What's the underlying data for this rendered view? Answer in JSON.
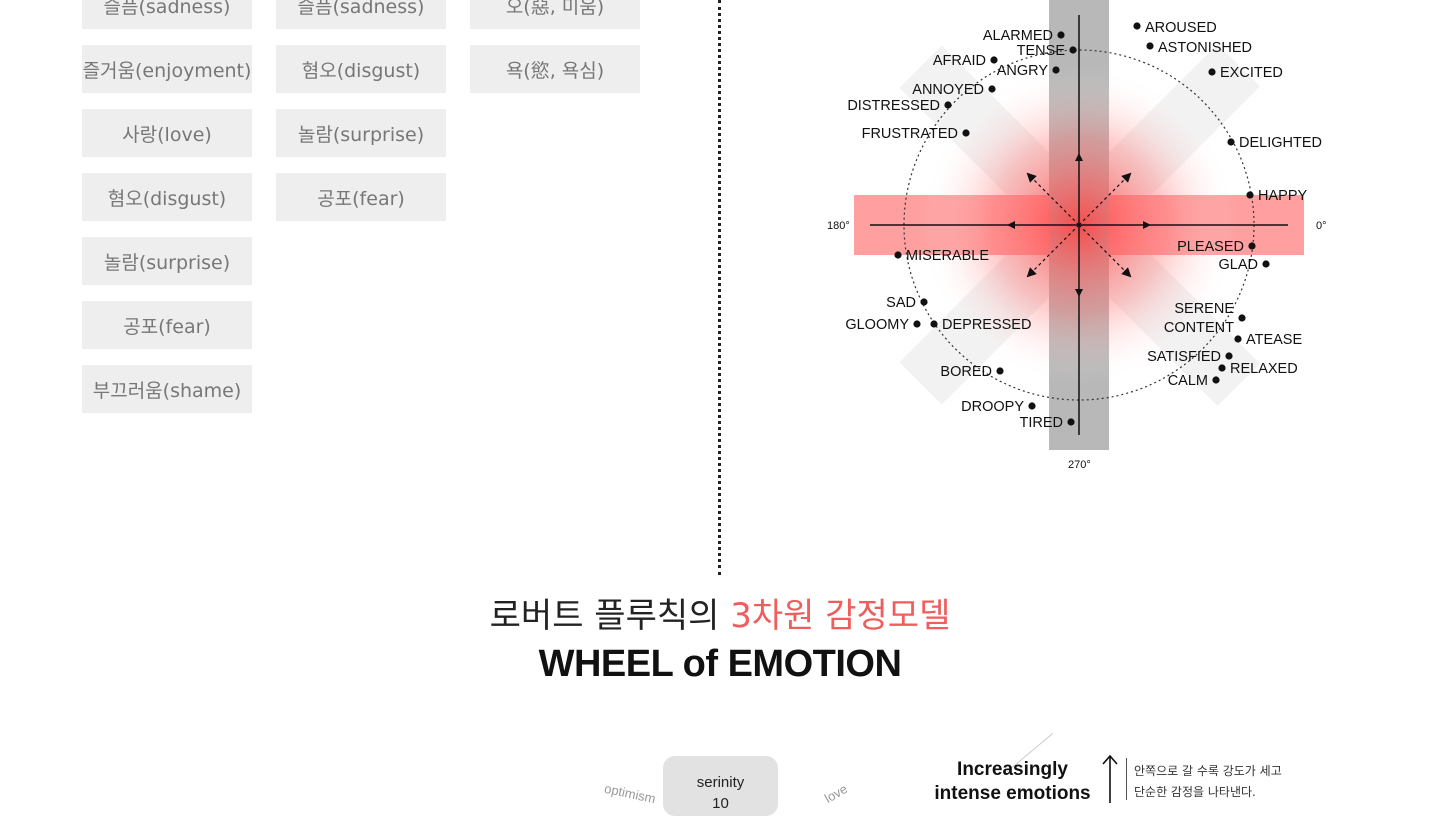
{
  "emotion_columns": [
    [
      "슬픔(sadness)",
      "즐거움(enjoyment)",
      "사랑(love)",
      "혐오(disgust)",
      "놀람(surprise)",
      "공포(fear)",
      "부끄러움(shame)"
    ],
    [
      "슬픔(sadness)",
      "혐오(disgust)",
      "놀람(surprise)",
      "공포(fear)"
    ],
    [
      "오(惡, 미움)",
      "욕(慾, 욕심)"
    ]
  ],
  "circumplex": {
    "degree_labels": {
      "right": "0°",
      "left": "180°",
      "bottom": "270°"
    },
    "words": {
      "aroused": "AROUSED",
      "astonished": "ASTONISHED",
      "alarmed": "ALARMED",
      "tense": "TENSE",
      "afraid": "AFRAID",
      "angry": "ANGRY",
      "excited": "EXCITED",
      "annoyed": "ANNOYED",
      "distressed": "DISTRESSED",
      "frustrated": "FRUSTRATED",
      "delighted": "DELIGHTED",
      "happy": "HAPPY",
      "pleased": "PLEASED",
      "glad": "GLAD",
      "miserable": "MISERABLE",
      "sad": "SAD",
      "gloomy": "GLOOMY",
      "depressed": "DEPRESSED",
      "serene": "SERENE",
      "content": "CONTENT",
      "atease": "ATEASE",
      "satisfied": "SATISFIED",
      "relaxed": "RELAXED",
      "calm": "CALM",
      "bored": "BORED",
      "droopy": "DROOPY",
      "tired": "TIRED"
    },
    "colors": {
      "valence_band": "#ff9fa0",
      "arousal_band": "#b8b8b8",
      "diagonal_band": "#f2f2f2",
      "glow": "#ff4a4a"
    }
  },
  "section_title": {
    "prefix": "로버트 플루칙의",
    "highlight": "3차원 감정모델",
    "english": "WHEEL of EMOTION",
    "highlight_color": "#f05d5d"
  },
  "wheel": {
    "center_label": "serinity",
    "center_value": "10",
    "petal_left": "optimism",
    "petal_right": "love"
  },
  "intensity_note": {
    "title_line1": "Increasingly",
    "title_line2": "intense emotions",
    "desc_line1": "안쪽으로 갈 수록 강도가 세고",
    "desc_line2": "단순한 감정을 나타낸다."
  }
}
